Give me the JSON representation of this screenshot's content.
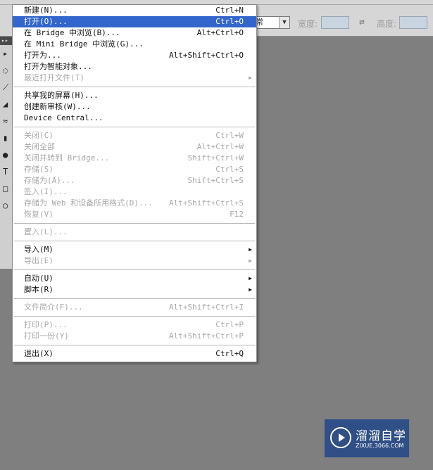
{
  "options_bar": {
    "style_value": "常",
    "width_label": "宽度:",
    "height_label": "高度:"
  },
  "file_menu": {
    "items": [
      {
        "label": "新建(N)...",
        "shortcut": "Ctrl+N",
        "disabled": false,
        "highlighted": false,
        "submenu": false
      },
      {
        "label": "打开(O)...",
        "shortcut": "Ctrl+O",
        "disabled": false,
        "highlighted": true,
        "submenu": false
      },
      {
        "label": "在 Bridge 中浏览(B)...",
        "shortcut": "Alt+Ctrl+O",
        "disabled": false,
        "highlighted": false,
        "submenu": false
      },
      {
        "label": "在 Mini Bridge 中浏览(G)...",
        "shortcut": "",
        "disabled": false,
        "highlighted": false,
        "submenu": false
      },
      {
        "label": "打开为...",
        "shortcut": "Alt+Shift+Ctrl+O",
        "disabled": false,
        "highlighted": false,
        "submenu": false
      },
      {
        "label": "打开为智能对象...",
        "shortcut": "",
        "disabled": false,
        "highlighted": false,
        "submenu": false
      },
      {
        "label": "最近打开文件(T)",
        "shortcut": "",
        "disabled": true,
        "highlighted": false,
        "submenu": true
      },
      {
        "separator": true
      },
      {
        "label": "共享我的屏幕(H)...",
        "shortcut": "",
        "disabled": false,
        "highlighted": false,
        "submenu": false
      },
      {
        "label": "创建新审核(W)...",
        "shortcut": "",
        "disabled": false,
        "highlighted": false,
        "submenu": false
      },
      {
        "label": "Device Central...",
        "shortcut": "",
        "disabled": false,
        "highlighted": false,
        "submenu": false
      },
      {
        "separator": true
      },
      {
        "label": "关闭(C)",
        "shortcut": "Ctrl+W",
        "disabled": true,
        "highlighted": false,
        "submenu": false
      },
      {
        "label": "关闭全部",
        "shortcut": "Alt+Ctrl+W",
        "disabled": true,
        "highlighted": false,
        "submenu": false
      },
      {
        "label": "关闭并转到 Bridge...",
        "shortcut": "Shift+Ctrl+W",
        "disabled": true,
        "highlighted": false,
        "submenu": false
      },
      {
        "label": "存储(S)",
        "shortcut": "Ctrl+S",
        "disabled": true,
        "highlighted": false,
        "submenu": false
      },
      {
        "label": "存储为(A)...",
        "shortcut": "Shift+Ctrl+S",
        "disabled": true,
        "highlighted": false,
        "submenu": false
      },
      {
        "label": "签入(I)...",
        "shortcut": "",
        "disabled": true,
        "highlighted": false,
        "submenu": false
      },
      {
        "label": "存储为 Web 和设备所用格式(D)...",
        "shortcut": "Alt+Shift+Ctrl+S",
        "disabled": true,
        "highlighted": false,
        "submenu": false
      },
      {
        "label": "恢复(V)",
        "shortcut": "F12",
        "disabled": true,
        "highlighted": false,
        "submenu": false
      },
      {
        "separator": true
      },
      {
        "label": "置入(L)...",
        "shortcut": "",
        "disabled": true,
        "highlighted": false,
        "submenu": false
      },
      {
        "separator": true
      },
      {
        "label": "导入(M)",
        "shortcut": "",
        "disabled": false,
        "highlighted": false,
        "submenu": true
      },
      {
        "label": "导出(E)",
        "shortcut": "",
        "disabled": true,
        "highlighted": false,
        "submenu": true
      },
      {
        "separator": true
      },
      {
        "label": "自动(U)",
        "shortcut": "",
        "disabled": false,
        "highlighted": false,
        "submenu": true
      },
      {
        "label": "脚本(R)",
        "shortcut": "",
        "disabled": false,
        "highlighted": false,
        "submenu": true
      },
      {
        "separator": true
      },
      {
        "label": "文件简介(F)...",
        "shortcut": "Alt+Shift+Ctrl+I",
        "disabled": true,
        "highlighted": false,
        "submenu": false
      },
      {
        "separator": true
      },
      {
        "label": "打印(P)...",
        "shortcut": "Ctrl+P",
        "disabled": true,
        "highlighted": false,
        "submenu": false
      },
      {
        "label": "打印一份(Y)",
        "shortcut": "Alt+Shift+Ctrl+P",
        "disabled": true,
        "highlighted": false,
        "submenu": false
      },
      {
        "separator": true
      },
      {
        "label": "退出(X)",
        "shortcut": "Ctrl+Q",
        "disabled": false,
        "highlighted": false,
        "submenu": false
      }
    ]
  },
  "watermark": {
    "name": "溜溜自学",
    "url": "ZIXUE.3066.COM"
  },
  "colors": {
    "highlight": "#3366cc",
    "workspace": "#7f7f7f",
    "watermark_bg": "#2f4f86"
  }
}
